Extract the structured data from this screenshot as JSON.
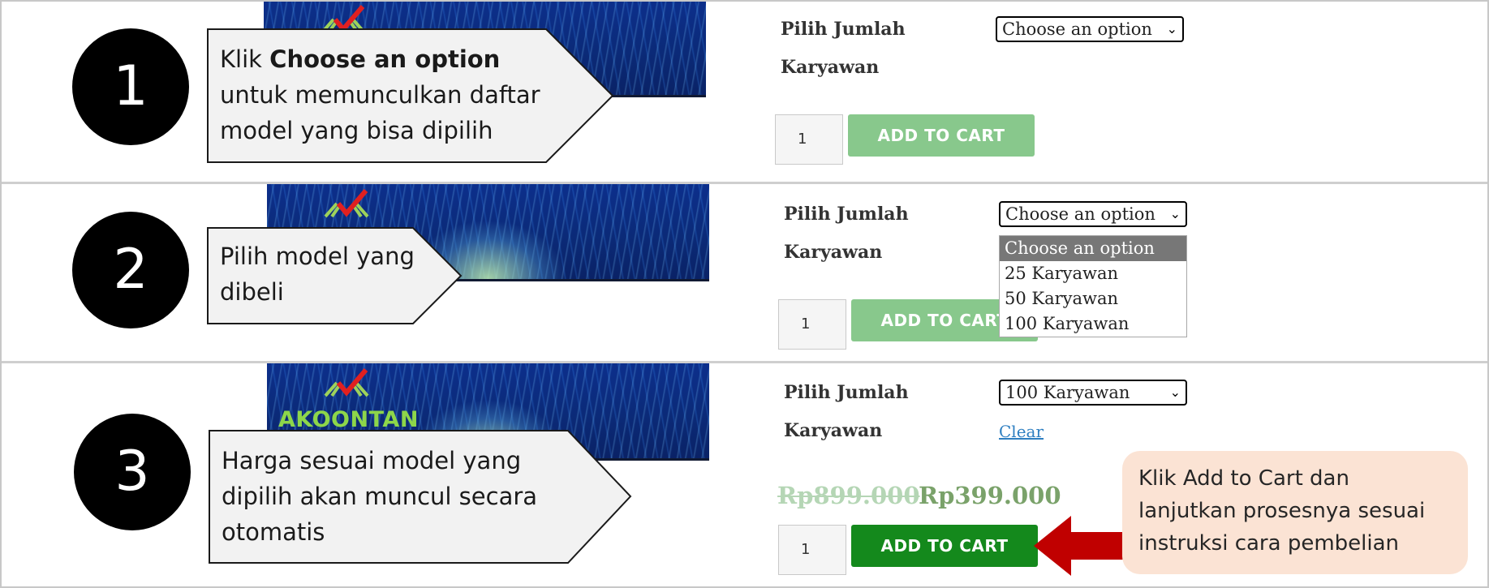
{
  "colors": {
    "circle": "#000000",
    "callout_fill": "#f2f2f2",
    "cart_disabled": "#88c88c",
    "cart_active": "#14891c",
    "arrow": "#c00000",
    "note_bg": "#fbe3d4",
    "clear_link": "#2e7fc1"
  },
  "banner": {
    "brand": "AKOONTAN",
    "logo_icon": "book-checkmark-icon"
  },
  "steps": [
    {
      "number": "1",
      "callout": {
        "prefix": "Klik ",
        "bold": "Choose an option",
        "rest": "untuk memunculkan daftar model yang bisa dipilih"
      },
      "form": {
        "label_line1": "Pilih Jumlah",
        "label_line2": "Karyawan",
        "select_value": "Choose an option",
        "qty": "1",
        "cart_label": "ADD TO CART"
      }
    },
    {
      "number": "2",
      "callout": {
        "text": "Pilih model yang dibeli"
      },
      "form": {
        "label_line1": "Pilih Jumlah",
        "label_line2": "Karyawan",
        "select_value": "Choose an option",
        "qty": "1",
        "cart_label": "ADD TO CART",
        "options": [
          "Choose an option",
          "25 Karyawan",
          "50 Karyawan",
          "100 Karyawan"
        ]
      }
    },
    {
      "number": "3",
      "callout": {
        "text": "Harga sesuai model yang dipilih akan muncul secara otomatis"
      },
      "form": {
        "label_line1": "Pilih Jumlah",
        "label_line2": "Karyawan",
        "select_value": "100 Karyawan",
        "clear_label": "Clear",
        "price_old": "Rp899.000",
        "price_new": "Rp399.000",
        "qty": "1",
        "cart_label": "ADD TO CART"
      },
      "note": "Klik Add to Cart dan lanjutkan prosesnya sesuai instruksi cara pembelian"
    }
  ]
}
